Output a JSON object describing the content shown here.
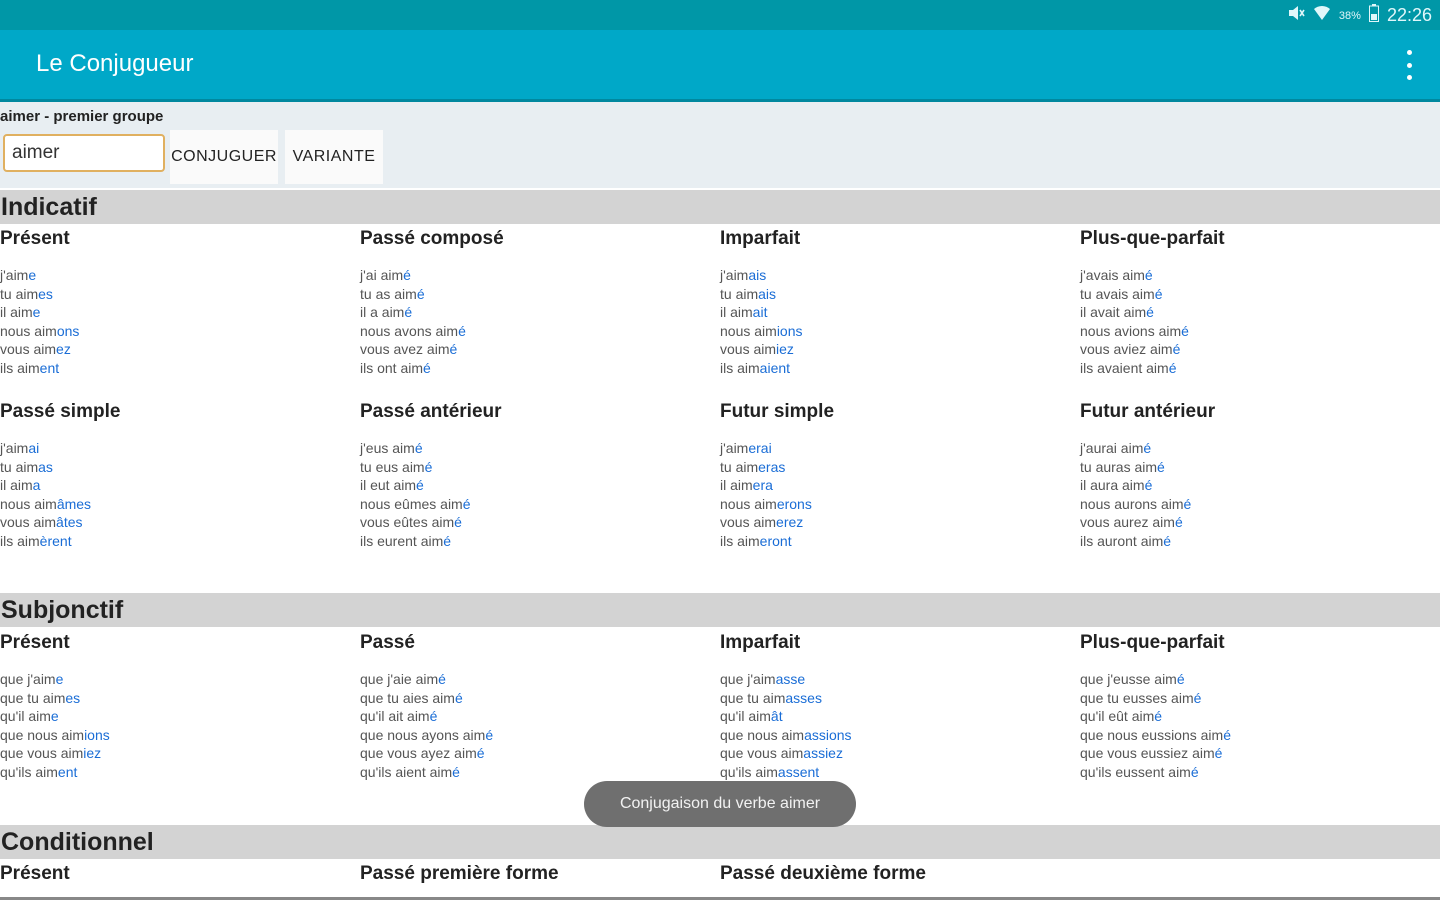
{
  "status_bar": {
    "battery": "38%",
    "time": "22:26"
  },
  "app_bar": {
    "title": "Le Conjugueur"
  },
  "controls": {
    "verb_info": "aimer - premier groupe",
    "input_value": "aimer",
    "conjuguer_label": "CONJUGUER",
    "variante_label": "VARIANTE"
  },
  "colors": {
    "accent": "#00a8c8",
    "status": "#0097a7",
    "ending": "#1a6dd6"
  },
  "icons": [
    "mute-icon",
    "wifi-icon",
    "battery-icon",
    "overflow-menu-icon"
  ],
  "sections": [
    {
      "title": "Indicatif",
      "tenses": [
        {
          "name": "Présent",
          "lines": [
            [
              "j'aim",
              "e"
            ],
            [
              "tu aim",
              "es"
            ],
            [
              "il aim",
              "e"
            ],
            [
              "nous aim",
              "ons"
            ],
            [
              "vous aim",
              "ez"
            ],
            [
              "ils aim",
              "ent"
            ]
          ]
        },
        {
          "name": "Passé composé",
          "lines": [
            [
              "j'ai aim",
              "é"
            ],
            [
              "tu as aim",
              "é"
            ],
            [
              "il a aim",
              "é"
            ],
            [
              "nous avons aim",
              "é"
            ],
            [
              "vous avez aim",
              "é"
            ],
            [
              "ils ont aim",
              "é"
            ]
          ]
        },
        {
          "name": "Imparfait",
          "lines": [
            [
              "j'aim",
              "ais"
            ],
            [
              "tu aim",
              "ais"
            ],
            [
              "il aim",
              "ait"
            ],
            [
              "nous aim",
              "ions"
            ],
            [
              "vous aim",
              "iez"
            ],
            [
              "ils aim",
              "aient"
            ]
          ]
        },
        {
          "name": "Plus-que-parfait",
          "lines": [
            [
              "j'avais aim",
              "é"
            ],
            [
              "tu avais aim",
              "é"
            ],
            [
              "il avait aim",
              "é"
            ],
            [
              "nous avions aim",
              "é"
            ],
            [
              "vous aviez aim",
              "é"
            ],
            [
              "ils avaient aim",
              "é"
            ]
          ]
        },
        {
          "name": "Passé simple",
          "lines": [
            [
              "j'aim",
              "ai"
            ],
            [
              "tu aim",
              "as"
            ],
            [
              "il aim",
              "a"
            ],
            [
              "nous aim",
              "âmes"
            ],
            [
              "vous aim",
              "âtes"
            ],
            [
              "ils aim",
              "èrent"
            ]
          ]
        },
        {
          "name": "Passé antérieur",
          "lines": [
            [
              "j'eus aim",
              "é"
            ],
            [
              "tu eus aim",
              "é"
            ],
            [
              "il eut aim",
              "é"
            ],
            [
              "nous eûmes aim",
              "é"
            ],
            [
              "vous eûtes aim",
              "é"
            ],
            [
              "ils eurent aim",
              "é"
            ]
          ]
        },
        {
          "name": "Futur simple",
          "lines": [
            [
              "j'aim",
              "erai"
            ],
            [
              "tu aim",
              "eras"
            ],
            [
              "il aim",
              "era"
            ],
            [
              "nous aim",
              "erons"
            ],
            [
              "vous aim",
              "erez"
            ],
            [
              "ils aim",
              "eront"
            ]
          ]
        },
        {
          "name": "Futur antérieur",
          "lines": [
            [
              "j'aurai aim",
              "é"
            ],
            [
              "tu auras aim",
              "é"
            ],
            [
              "il aura aim",
              "é"
            ],
            [
              "nous aurons aim",
              "é"
            ],
            [
              "vous aurez aim",
              "é"
            ],
            [
              "ils auront aim",
              "é"
            ]
          ]
        }
      ]
    },
    {
      "title": "Subjonctif",
      "tenses": [
        {
          "name": "Présent",
          "lines": [
            [
              "que j'aim",
              "e"
            ],
            [
              "que tu aim",
              "es"
            ],
            [
              "qu'il aim",
              "e"
            ],
            [
              "que nous aim",
              "ions"
            ],
            [
              "que vous aim",
              "iez"
            ],
            [
              "qu'ils aim",
              "ent"
            ]
          ]
        },
        {
          "name": "Passé",
          "lines": [
            [
              "que j'aie aim",
              "é"
            ],
            [
              "que tu aies aim",
              "é"
            ],
            [
              "qu'il ait aim",
              "é"
            ],
            [
              "que nous ayons aim",
              "é"
            ],
            [
              "que vous ayez aim",
              "é"
            ],
            [
              "qu'ils aient aim",
              "é"
            ]
          ]
        },
        {
          "name": "Imparfait",
          "lines": [
            [
              "que j'aim",
              "asse"
            ],
            [
              "que tu aim",
              "asses"
            ],
            [
              "qu'il aim",
              "ât"
            ],
            [
              "que nous aim",
              "assions"
            ],
            [
              "que vous aim",
              "assiez"
            ],
            [
              "qu'ils aim",
              "assent"
            ]
          ]
        },
        {
          "name": "Plus-que-parfait",
          "lines": [
            [
              "que j'eusse aim",
              "é"
            ],
            [
              "que tu eusses aim",
              "é"
            ],
            [
              "qu'il eût aim",
              "é"
            ],
            [
              "que nous eussions aim",
              "é"
            ],
            [
              "que vous eussiez aim",
              "é"
            ],
            [
              "qu'ils eussent aim",
              "é"
            ]
          ]
        }
      ]
    },
    {
      "title": "Conditionnel",
      "tenses": [
        {
          "name": "Présent",
          "lines": []
        },
        {
          "name": "Passé première forme",
          "lines": []
        },
        {
          "name": "Passé deuxième forme",
          "lines": []
        }
      ]
    }
  ],
  "toast": "Conjugaison du verbe aimer"
}
